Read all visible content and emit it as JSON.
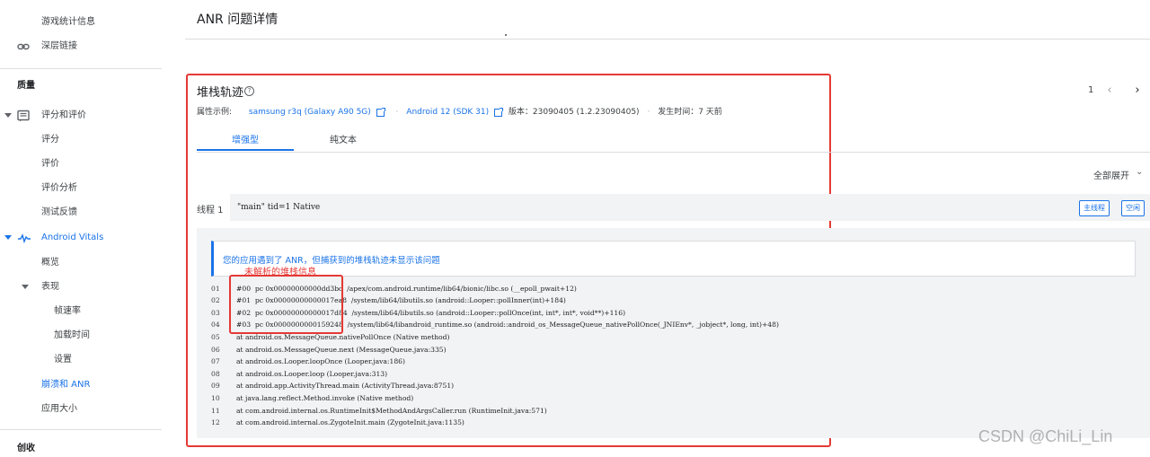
{
  "sidebar": {
    "items": [
      {
        "label": "游戏统计信息"
      },
      {
        "label": "深层链接",
        "icon": "link-icon"
      },
      {
        "label": "质量",
        "section": true
      },
      {
        "label": "评分和评价",
        "icon": "rating-review-icon"
      },
      {
        "label": "评分"
      },
      {
        "label": "评价"
      },
      {
        "label": "评价分析"
      },
      {
        "label": "测试反馈"
      },
      {
        "label": "Android Vitals",
        "icon": "vitals-icon"
      },
      {
        "label": "概览"
      },
      {
        "label": "表现"
      },
      {
        "label": "帧速率"
      },
      {
        "label": "加载时间"
      },
      {
        "label": "设置"
      },
      {
        "label": "崩溃和 ANR"
      },
      {
        "label": "应用大小"
      },
      {
        "label": "创收",
        "section": true
      }
    ]
  },
  "header": {
    "title": "ANR 问题详情"
  },
  "card": {
    "title": "堆栈轨迹",
    "help_glyph": "?",
    "pager": {
      "count": "1",
      "prev": "‹",
      "next": "›"
    },
    "meta": {
      "label": "属性示例:",
      "device": "samsung r3q (Galaxy A90 5G)",
      "os": "Android 12 (SDK 31)",
      "version": "版本：23090405 (1.2.23090405)",
      "time": "发生时间：7 天前",
      "separator": "·"
    },
    "tabs": [
      {
        "label": "增强型",
        "active": true
      },
      {
        "label": "纯文本",
        "active": false
      }
    ],
    "expand_all": "全部展开",
    "expand_glyph": "⌄",
    "thread": {
      "label": "线程 1",
      "text": "\"main\" tid=1 Native",
      "chips": [
        "主线程",
        "空闲"
      ]
    },
    "notice": "您的应用遇到了 ANR，但捕获到的堆栈轨迹未显示该问题",
    "annotation": "未解析的堆栈信息",
    "stack_lines": [
      {
        "n": "01",
        "text": "#00  pc 0x00000000000dd3bc  /apex/com.android.runtime/lib64/bionic/libc.so (__epoll_pwait+12)"
      },
      {
        "n": "02",
        "text": "#01  pc 0x00000000000017ea8  /system/lib64/libutils.so (android::Looper::pollInner(int)+184)"
      },
      {
        "n": "03",
        "text": "#02  pc 0x00000000000017d84  /system/lib64/libutils.so (android::Looper::pollOnce(int, int*, int*, void**)+116)"
      },
      {
        "n": "04",
        "text": "#03  pc 0x0000000000159248  /system/lib64/libandroid_runtime.so (android::android_os_MessageQueue_nativePollOnce(_JNIEnv*, _jobject*, long, int)+48)"
      },
      {
        "n": "05",
        "text": "at android.os.MessageQueue.nativePollOnce (Native method)"
      },
      {
        "n": "06",
        "text": "at android.os.MessageQueue.next (MessageQueue.java:335)"
      },
      {
        "n": "07",
        "text": "at android.os.Looper.loopOnce (Looper.java:186)"
      },
      {
        "n": "08",
        "text": "at android.os.Looper.loop (Looper.java:313)"
      },
      {
        "n": "09",
        "text": "at android.app.ActivityThread.main (ActivityThread.java:8751)"
      },
      {
        "n": "10",
        "text": "at java.lang.reflect.Method.invoke (Native method)"
      },
      {
        "n": "11",
        "text": "at com.android.internal.os.RuntimeInit$MethodAndArgsCaller.run (RuntimeInit.java:571)"
      },
      {
        "n": "12",
        "text": "at com.android.internal.os.ZygoteInit.main (ZygoteInit.java:1135)"
      }
    ]
  },
  "watermark": "CSDN @ChiLi_Lin",
  "colors": {
    "accent": "#1a73e8",
    "annotation": "#e53935",
    "code_bg": "#f1f3f4"
  }
}
